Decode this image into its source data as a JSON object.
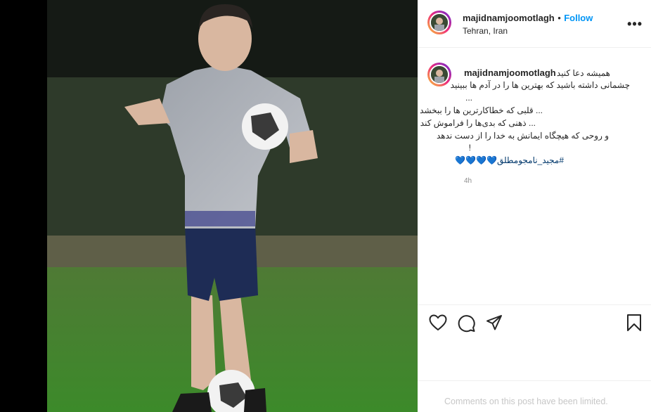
{
  "post": {
    "username": "majidnamjoomotlagh",
    "follow_label": "Follow",
    "separator": "•",
    "location": "Tehran, Iran",
    "more_label": "•••",
    "caption_lines": [
      "همیشه دعا کنید",
      "چشمانی داشته باشید که بهترین ها را در آدم ها ببینید",
      "...",
      "... قلبی که خطاکارترین ها را ببخشد",
      "... ذهنی که بدی‌ها را فراموش کند",
      "و روحی که هیچگاه ایمانش به خدا را از دست ندهد",
      "!"
    ],
    "hashtag": "#مجید_نامجومطلق",
    "hearts": "💙💙💙💙",
    "time": "4h",
    "comments_limited": "Comments on this post have been limited."
  },
  "colors": {
    "accent": "#0095f6",
    "text": "#262626",
    "muted": "#8e8e8e",
    "heart_blue": "#3897f0"
  },
  "icons": [
    "heart-icon",
    "comment-icon",
    "share-icon",
    "bookmark-icon",
    "more-options-icon"
  ]
}
